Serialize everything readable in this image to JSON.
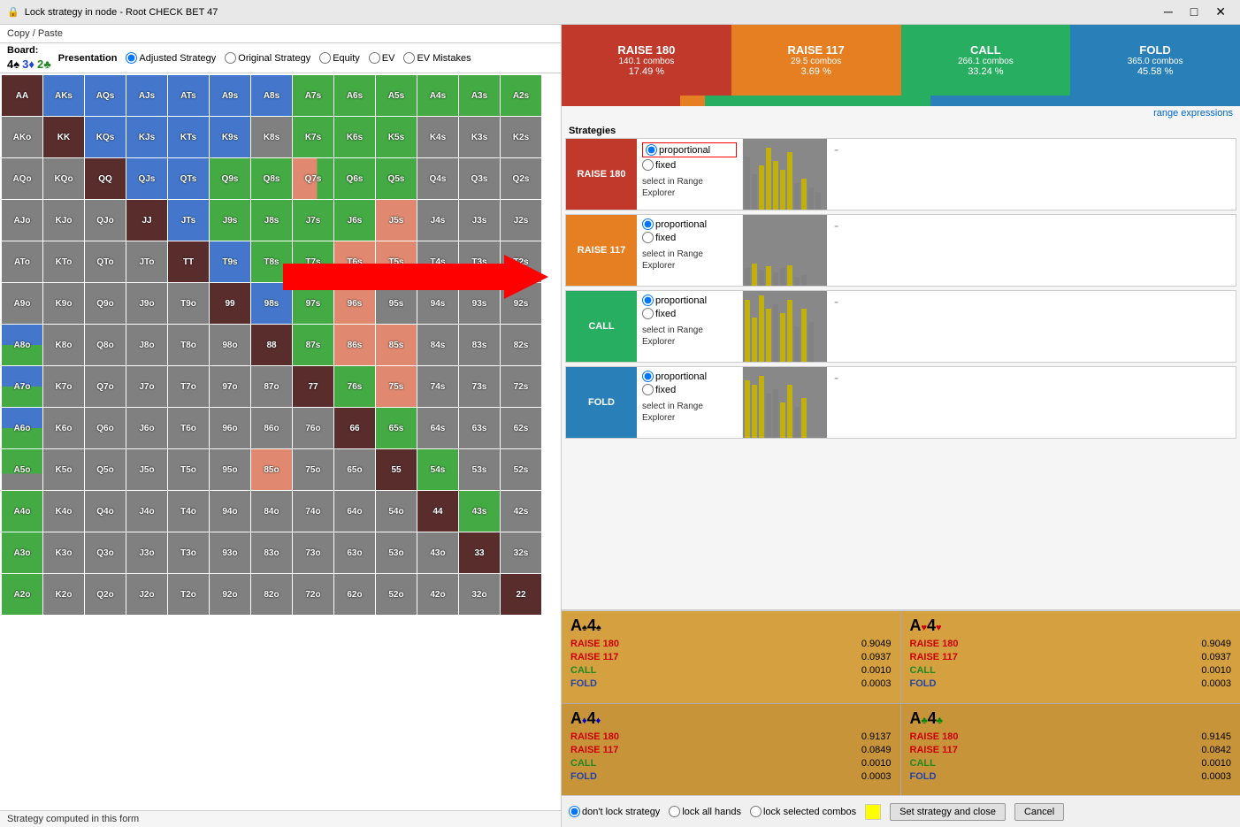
{
  "window": {
    "title": "Lock strategy in node  - Root CHECK BET 47",
    "icon": "lock-icon"
  },
  "toolbar": {
    "copy_paste": "Copy / Paste",
    "board_label": "Board:",
    "cards": [
      {
        "rank": "4",
        "suit": "♠",
        "color": "black"
      },
      {
        "rank": "3",
        "suit": "♦",
        "color": "blue"
      },
      {
        "rank": "2",
        "suit": "♣",
        "color": "green"
      }
    ]
  },
  "presentation": {
    "label": "Presentation",
    "options": [
      {
        "id": "adjusted",
        "label": "Adjusted Strategy",
        "selected": true
      },
      {
        "id": "original",
        "label": "Original Strategy",
        "selected": false
      },
      {
        "id": "equity",
        "label": "Equity",
        "selected": false
      },
      {
        "id": "ev",
        "label": "EV",
        "selected": false
      },
      {
        "id": "ev_mistakes",
        "label": "EV Mistakes",
        "selected": false
      }
    ]
  },
  "actions": [
    {
      "name": "RAISE 180",
      "combos": "140.1 combos",
      "pct": "17.49 %",
      "class": "raise180",
      "bar_pct": 17.49
    },
    {
      "name": "RAISE 117",
      "combos": "29.5 combos",
      "pct": "3.69 %",
      "class": "raise117",
      "bar_pct": 3.69
    },
    {
      "name": "CALL",
      "combos": "266.1 combos",
      "pct": "33.24 %",
      "class": "call",
      "bar_pct": 33.24
    },
    {
      "name": "FOLD",
      "combos": "365.0 combos",
      "pct": "45.58 %",
      "class": "fold",
      "bar_pct": 45.58
    }
  ],
  "range_expressions_link": "range expressions",
  "strategies_label": "Strategies",
  "strategies": [
    {
      "name": "RAISE 180",
      "class": "raise180",
      "proportional_selected": true,
      "fixed_selected": false,
      "proportional_label": "proportional",
      "fixed_label": "fixed",
      "select_range_label": "select in Range Explorer"
    },
    {
      "name": "RAISE 117",
      "class": "raise117",
      "proportional_selected": true,
      "fixed_selected": false,
      "proportional_label": "proportional",
      "fixed_label": "fixed",
      "select_range_label": "select in Range Explorer"
    },
    {
      "name": "CALL",
      "class": "call",
      "proportional_selected": true,
      "fixed_selected": false,
      "proportional_label": "proportional",
      "fixed_label": "fixed",
      "select_range_label": "select in Range Explorer"
    },
    {
      "name": "FOLD",
      "class": "fold",
      "proportional_selected": true,
      "fixed_selected": false,
      "proportional_label": "proportional",
      "fixed_label": "fixed",
      "select_range_label": "select in Range Explorer"
    }
  ],
  "combos": [
    {
      "hand": "A♠4♠",
      "suit_classes": [
        "spade",
        "spade"
      ],
      "actions": [
        {
          "name": "RAISE 180",
          "value": "0.9049"
        },
        {
          "name": "RAISE 117",
          "value": "0.0937"
        },
        {
          "name": "CALL",
          "value": "0.0010"
        },
        {
          "name": "FOLD",
          "value": "0.0003"
        }
      ]
    },
    {
      "hand": "A♥4♥",
      "suit_classes": [
        "heart",
        "heart"
      ],
      "actions": [
        {
          "name": "RAISE 180",
          "value": "0.9049"
        },
        {
          "name": "RAISE 117",
          "value": "0.0937"
        },
        {
          "name": "CALL",
          "value": "0.0010"
        },
        {
          "name": "FOLD",
          "value": "0.0003"
        }
      ]
    },
    {
      "hand": "A♦4♦",
      "suit_classes": [
        "diamond",
        "diamond"
      ],
      "actions": [
        {
          "name": "RAISE 180",
          "value": "0.9137"
        },
        {
          "name": "RAISE 117",
          "value": "0.0849"
        },
        {
          "name": "CALL",
          "value": "0.0010"
        },
        {
          "name": "FOLD",
          "value": "0.0003"
        }
      ]
    },
    {
      "hand": "A♣4♣",
      "suit_classes": [
        "club",
        "club"
      ],
      "actions": [
        {
          "name": "RAISE 180",
          "value": "0.9145"
        },
        {
          "name": "RAISE 117",
          "value": "0.0842"
        },
        {
          "name": "CALL",
          "value": "0.0010"
        },
        {
          "name": "FOLD",
          "value": "0.0003"
        }
      ]
    }
  ],
  "bottom_controls": {
    "lock_options": [
      {
        "id": "dont_lock",
        "label": "don't lock strategy",
        "selected": true
      },
      {
        "id": "lock_all",
        "label": "lock all hands",
        "selected": false
      },
      {
        "id": "lock_selected",
        "label": "lock selected combos",
        "selected": false
      }
    ],
    "set_button": "Set strategy and close",
    "cancel_button": "Cancel"
  },
  "status_bar": "Strategy computed in this form",
  "grid_rows": [
    [
      "AA",
      "AKs",
      "AQs",
      "AJs",
      "ATs",
      "A9s",
      "A8s",
      "A7s",
      "A6s",
      "A5s",
      "A4s",
      "A3s",
      "A2s"
    ],
    [
      "AKo",
      "KK",
      "KQs",
      "KJs",
      "KTs",
      "K9s",
      "K8s",
      "K7s",
      "K6s",
      "K5s",
      "K4s",
      "K3s",
      "K2s"
    ],
    [
      "AQo",
      "KQo",
      "QQ",
      "QJs",
      "QTs",
      "Q9s",
      "Q8s",
      "Q7s",
      "Q6s",
      "Q5s",
      "Q4s",
      "Q3s",
      "Q2s"
    ],
    [
      "AJo",
      "KJo",
      "QJo",
      "JJ",
      "JTs",
      "J9s",
      "J8s",
      "J7s",
      "J6s",
      "J5s",
      "J4s",
      "J3s",
      "J2s"
    ],
    [
      "ATo",
      "KTo",
      "QTo",
      "JTo",
      "TT",
      "T9s",
      "T8s",
      "T7s",
      "T6s",
      "T5s",
      "T4s",
      "T3s",
      "T2s"
    ],
    [
      "A9o",
      "K9o",
      "Q9o",
      "J9o",
      "T9o",
      "99",
      "98s",
      "97s",
      "96s",
      "95s",
      "94s",
      "93s",
      "92s"
    ],
    [
      "A8o",
      "K8o",
      "Q8o",
      "J8o",
      "T8o",
      "98o",
      "88",
      "87s",
      "86s",
      "85s",
      "84s",
      "83s",
      "82s"
    ],
    [
      "A7o",
      "K7o",
      "Q7o",
      "J7o",
      "T7o",
      "97o",
      "87o",
      "77",
      "76s",
      "75s",
      "74s",
      "73s",
      "72s"
    ],
    [
      "A6o",
      "K6o",
      "Q6o",
      "J6o",
      "T6o",
      "96o",
      "86o",
      "76o",
      "66",
      "65s",
      "64s",
      "63s",
      "62s"
    ],
    [
      "A5o",
      "K5o",
      "Q5o",
      "J5o",
      "T5o",
      "95o",
      "85o",
      "75o",
      "65o",
      "55",
      "54s",
      "53s",
      "52s"
    ],
    [
      "A4o",
      "K4o",
      "Q4o",
      "J4o",
      "T4o",
      "94o",
      "84o",
      "74o",
      "64o",
      "54o",
      "44",
      "43s",
      "42s"
    ],
    [
      "A3o",
      "K3o",
      "Q3o",
      "J3o",
      "T3o",
      "93o",
      "83o",
      "73o",
      "63o",
      "53o",
      "43o",
      "33",
      "32s"
    ],
    [
      "A2o",
      "K2o",
      "Q2o",
      "J2o",
      "T2o",
      "92o",
      "82o",
      "72o",
      "62o",
      "52o",
      "42o",
      "32o",
      "22"
    ]
  ]
}
